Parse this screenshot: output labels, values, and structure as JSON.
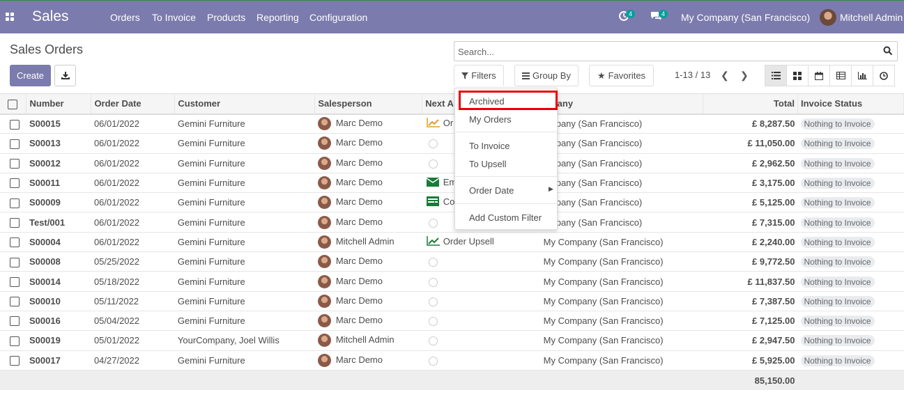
{
  "topbar": {
    "app_name": "Sales",
    "menu": [
      "Orders",
      "To Invoice",
      "Products",
      "Reporting",
      "Configuration"
    ],
    "activity_count": "4",
    "messages_count": "4",
    "company": "My Company (San Francisco)",
    "user": "Mitchell Admin"
  },
  "page": {
    "title": "Sales Orders",
    "create_label": "Create",
    "search_placeholder": "Search...",
    "filters_label": "Filters",
    "groupby_label": "Group By",
    "favorites_label": "Favorites",
    "pager": "1-13 / 13"
  },
  "filters_menu": {
    "items": [
      "Archived",
      "My Orders",
      "To Invoice",
      "To Upsell",
      "Order Date",
      "Add Custom Filter"
    ]
  },
  "table": {
    "columns": [
      "Number",
      "Order Date",
      "Customer",
      "Salesperson",
      "Next A",
      "mpany",
      "Total",
      "Invoice Status"
    ],
    "rows": [
      {
        "number": "S00015",
        "date": "06/01/2022",
        "customer": "Gemini Furniture",
        "salesperson": "Marc Demo",
        "activity": "Or",
        "company": "ompany (San Francisco)",
        "total": "£ 8,287.50",
        "status": "Nothing to Invoice"
      },
      {
        "number": "S00013",
        "date": "06/01/2022",
        "customer": "Gemini Furniture",
        "salesperson": "Marc Demo",
        "activity": "",
        "company": "ompany (San Francisco)",
        "total": "£ 11,050.00",
        "status": "Nothing to Invoice"
      },
      {
        "number": "S00012",
        "date": "06/01/2022",
        "customer": "Gemini Furniture",
        "salesperson": "Marc Demo",
        "activity": "",
        "company": "ompany (San Francisco)",
        "total": "£ 2,962.50",
        "status": "Nothing to Invoice"
      },
      {
        "number": "S00011",
        "date": "06/01/2022",
        "customer": "Gemini Furniture",
        "salesperson": "Marc Demo",
        "activity": "Em",
        "company": "ompany (San Francisco)",
        "total": "£ 3,175.00",
        "status": "Nothing to Invoice"
      },
      {
        "number": "S00009",
        "date": "06/01/2022",
        "customer": "Gemini Furniture",
        "salesperson": "Marc Demo",
        "activity": "Co",
        "company": "ompany (San Francisco)",
        "total": "£ 5,125.00",
        "status": "Nothing to Invoice"
      },
      {
        "number": "Test/001",
        "date": "06/01/2022",
        "customer": "Gemini Furniture",
        "salesperson": "Marc Demo",
        "activity": "",
        "company": "ompany (San Francisco)",
        "total": "£ 7,315.00",
        "status": "Nothing to Invoice"
      },
      {
        "number": "S00004",
        "date": "06/01/2022",
        "customer": "Gemini Furniture",
        "salesperson": "Mitchell Admin",
        "activity": "Order Upsell",
        "company": "My Company (San Francisco)",
        "total": "£ 2,240.00",
        "status": "Nothing to Invoice"
      },
      {
        "number": "S00008",
        "date": "05/25/2022",
        "customer": "Gemini Furniture",
        "salesperson": "Marc Demo",
        "activity": "",
        "company": "My Company (San Francisco)",
        "total": "£ 9,772.50",
        "status": "Nothing to Invoice"
      },
      {
        "number": "S00014",
        "date": "05/18/2022",
        "customer": "Gemini Furniture",
        "salesperson": "Marc Demo",
        "activity": "",
        "company": "My Company (San Francisco)",
        "total": "£ 11,837.50",
        "status": "Nothing to Invoice"
      },
      {
        "number": "S00010",
        "date": "05/11/2022",
        "customer": "Gemini Furniture",
        "salesperson": "Marc Demo",
        "activity": "",
        "company": "My Company (San Francisco)",
        "total": "£ 7,387.50",
        "status": "Nothing to Invoice"
      },
      {
        "number": "S00016",
        "date": "05/04/2022",
        "customer": "Gemini Furniture",
        "salesperson": "Marc Demo",
        "activity": "",
        "company": "My Company (San Francisco)",
        "total": "£ 7,125.00",
        "status": "Nothing to Invoice"
      },
      {
        "number": "S00019",
        "date": "05/01/2022",
        "customer": "YourCompany, Joel Willis",
        "salesperson": "Mitchell Admin",
        "activity": "",
        "company": "My Company (San Francisco)",
        "total": "£ 2,947.50",
        "status": "Nothing to Invoice"
      },
      {
        "number": "S00017",
        "date": "04/27/2022",
        "customer": "Gemini Furniture",
        "salesperson": "Marc Demo",
        "activity": "",
        "company": "My Company (San Francisco)",
        "total": "£ 5,925.00",
        "status": "Nothing to Invoice"
      }
    ],
    "grand_total": "85,150.00"
  },
  "colors": {
    "brand": "#7c7bad",
    "highlight": "#e00000",
    "badge": "#00a09d"
  }
}
